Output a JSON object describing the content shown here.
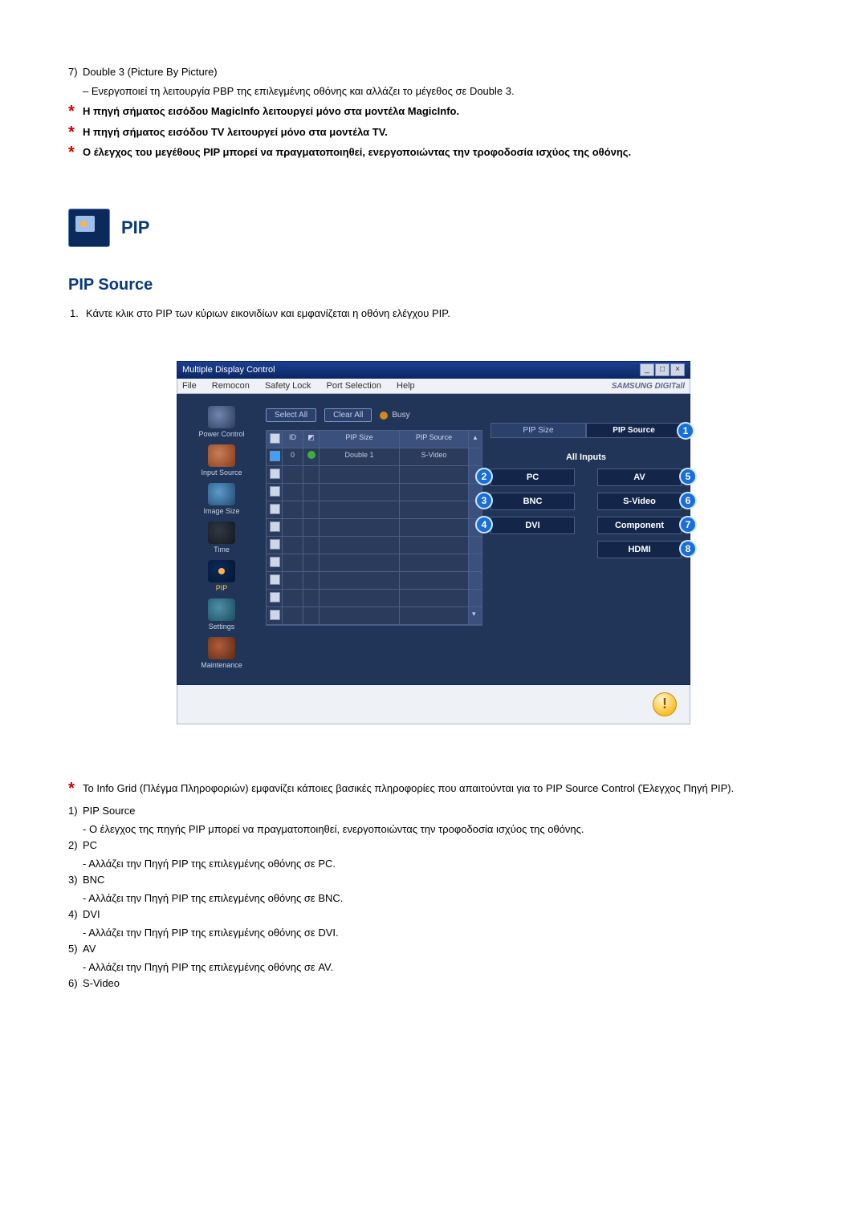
{
  "top_item7": {
    "num": "7)",
    "title": "Double 3 (Picture By Picture)",
    "desc": "– Ενεργοποιεί τη λειτουργία PBP της επιλεγμένης οθόνης και αλλάζει το μέγεθος σε Double 3."
  },
  "stars": {
    "s1": "Η πηγή σήματος εισόδου MagicInfo λειτουργεί μόνο στα μοντέλα MagicInfo.",
    "s2": "Η πηγή σήματος εισόδου TV λειτουργεί μόνο στα μοντέλα TV.",
    "s3": "Ο έλεγχος του μεγέθους PIP μπορεί να πραγματοποιηθεί, ενεργοποιώντας την τροφοδοσία ισχύος της οθόνης."
  },
  "section": {
    "title": "PIP",
    "sub": "PIP Source",
    "step1_num": "1.",
    "step1": "Κάντε κλικ στο PIP των κύριων εικονιδίων και εμφανίζεται η οθόνη ελέγχου PIP."
  },
  "app": {
    "title": "Multiple Display Control",
    "menu": {
      "file": "File",
      "remocon": "Remocon",
      "safety": "Safety Lock",
      "port": "Port Selection",
      "help": "Help"
    },
    "brand": "SAMSUNG DIGITall",
    "sidebar": {
      "power": "Power Control",
      "input": "Input Source",
      "image": "Image Size",
      "time": "Time",
      "pip": "PIP",
      "settings": "Settings",
      "maint": "Maintenance"
    },
    "btn_select_all": "Select All",
    "btn_clear_all": "Clear All",
    "busy": "Busy",
    "col_id": "ID",
    "col_pipsize": "PIP Size",
    "col_pipsource": "PIP Source",
    "row0_id": "0",
    "row0_size": "Double 1",
    "row0_source": "S-Video",
    "tab_size": "PIP Size",
    "tab_source": "PIP Source",
    "all_inputs": "All Inputs",
    "in_pc": "PC",
    "in_bnc": "BNC",
    "in_dvi": "DVI",
    "in_av": "AV",
    "in_svideo": "S-Video",
    "in_component": "Component",
    "in_hdmi": "HDMI",
    "annot": {
      "a1": "1",
      "a2": "2",
      "a3": "3",
      "a4": "4",
      "a5": "5",
      "a6": "6",
      "a7": "7",
      "a8": "8"
    }
  },
  "desc": {
    "star_text": "Το Info Grid (Πλέγμα Πληροφοριών) εμφανίζει κάποιες βασικές πληροφορίες που απαιτούνται για το PIP Source Control (Έλεγχος Πηγή PIP).",
    "d1_num": "1)",
    "d1_title": "PIP Source",
    "d1_body": "- Ο έλεγχος της πηγής PIP μπορεί να πραγματοποιηθεί, ενεργοποιώντας την τροφοδοσία ισχύος της οθόνης.",
    "d2_num": "2)",
    "d2_title": "PC",
    "d2_body": "- Αλλάζει την Πηγή PIP της επιλεγμένης οθόνης σε PC.",
    "d3_num": "3)",
    "d3_title": "BNC",
    "d3_body": "- Αλλάζει την Πηγή PIP της επιλεγμένης οθόνης σε BNC.",
    "d4_num": "4)",
    "d4_title": "DVI",
    "d4_body": "- Αλλάζει την Πηγή PIP της επιλεγμένης οθόνης σε DVI.",
    "d5_num": "5)",
    "d5_title": "AV",
    "d5_body": "- Αλλάζει την Πηγή PIP της επιλεγμένης οθόνης σε AV.",
    "d6_num": "6)",
    "d6_title": "S-Video"
  }
}
